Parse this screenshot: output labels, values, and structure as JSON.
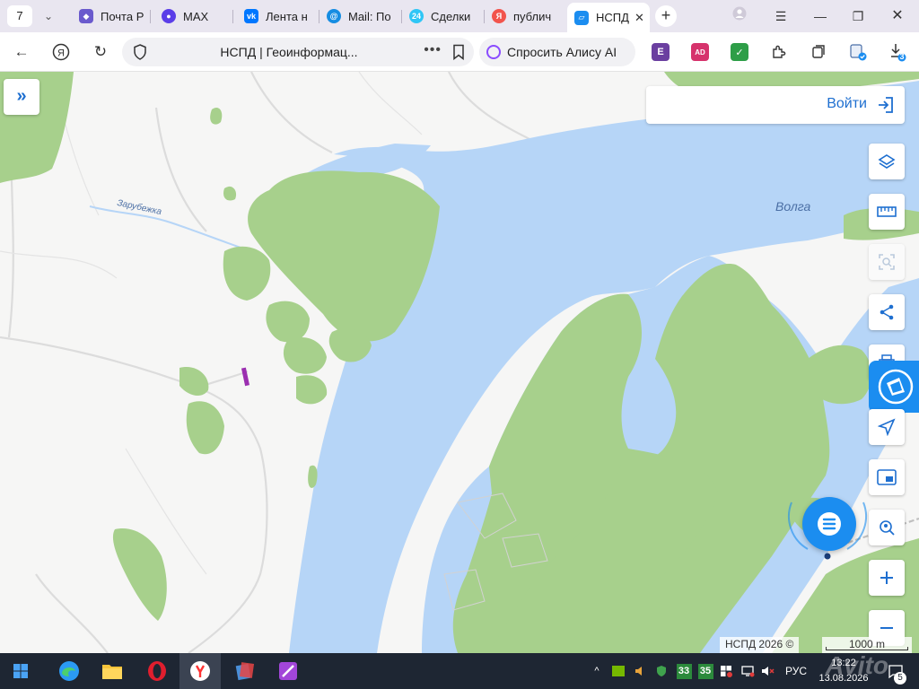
{
  "browser": {
    "tab_count": "7",
    "tabs": [
      {
        "title": "Почта Р",
        "icon": "cube-icon",
        "color": "#6a5acd"
      },
      {
        "title": "MAX",
        "icon": "max-messenger-icon",
        "color": "#5b3ee8"
      },
      {
        "title": "Лента н",
        "icon": "vk-icon",
        "color": "#0077ff"
      },
      {
        "title": "Mail: По",
        "icon": "mail-at-icon",
        "color": "#168de2"
      },
      {
        "title": "Сделки",
        "icon": "bitrix24-icon",
        "color": "#2fc6f6"
      },
      {
        "title": "публич",
        "icon": "yandex-icon",
        "color": "#f2544c"
      },
      {
        "title": "НСПД",
        "icon": "nspd-icon",
        "color": "#1b8df0",
        "active": true
      }
    ],
    "address": {
      "page_title": "НСПД | Геоинформац...",
      "alice_label": "Спросить Алису AI"
    },
    "extensions": [
      {
        "name": "e-extension-icon",
        "label": "E",
        "color": "#6b3fa0"
      },
      {
        "name": "ad-extension-icon",
        "label": "AD",
        "color": "#d6336c"
      },
      {
        "name": "shield-check-extension-icon",
        "label": "✓",
        "color": "#2e9e48"
      }
    ],
    "downloads_badge": "3"
  },
  "map": {
    "labels": {
      "volga": "Волга",
      "zarubezhka": "Зарубежка"
    },
    "login_label": "Войти",
    "attribution": "НСПД 2026 ©",
    "scale_label": "1000 m",
    "colors": {
      "water": "#b6d5f7",
      "forest": "#a7d08c",
      "land": "#f6f6f5",
      "accent": "#1b8df0"
    },
    "controls": [
      "layers-icon",
      "ruler-icon",
      "area-select-icon",
      "share-icon",
      "print-icon",
      "locate-icon",
      "minimap-icon",
      "search-location-icon",
      "zoom-in-icon",
      "zoom-out-icon"
    ]
  },
  "taskbar": {
    "time": "13:22",
    "date": "13.08.2026",
    "language": "РУС",
    "badge_1": "33",
    "badge_2": "35",
    "notifications": "5",
    "apps": [
      "windows-start-icon",
      "edge-icon",
      "file-explorer-icon",
      "opera-icon",
      "yandex-browser-icon",
      "app-icon-5",
      "app-icon-6"
    ]
  },
  "watermark": "Avito"
}
